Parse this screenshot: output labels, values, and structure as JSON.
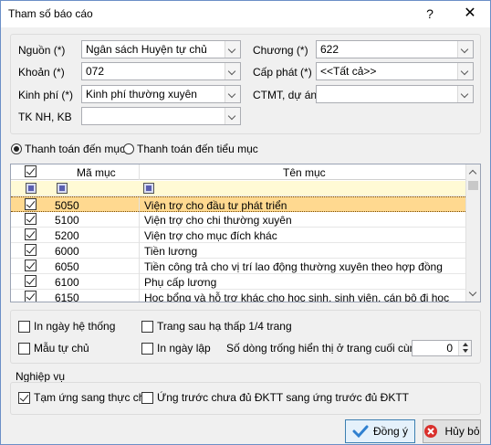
{
  "window": {
    "title": "Tham số báo cáo",
    "help": "?",
    "close": "✕"
  },
  "params": {
    "nguon": {
      "label": "Nguồn (*)",
      "value": "Ngân sách Huyện tự chủ"
    },
    "khoan": {
      "label": "Khoản (*)",
      "value": "072"
    },
    "kinhphi": {
      "label": "Kinh phí (*)",
      "value": "Kinh phí thường xuyên"
    },
    "tknh": {
      "label": "TK NH, KB",
      "value": ""
    },
    "chuong": {
      "label": "Chương (*)",
      "value": "622"
    },
    "capphat": {
      "label": "Cấp phát (*)",
      "value": "<<Tất cả>>"
    },
    "ctmt": {
      "label": "CTMT, dự án",
      "value": ""
    }
  },
  "mode": {
    "option1": "Thanh toán đến mục",
    "option2": "Thanh toán đến tiểu mục",
    "selected": "option1"
  },
  "grid": {
    "col_code": "Mã mục",
    "col_name": "Tên mục",
    "rows": [
      {
        "code": "5050",
        "name": "Viện trợ cho đầu tư phát triển",
        "checked": true,
        "selected": true
      },
      {
        "code": "5100",
        "name": "Viện trợ cho chi thường xuyên",
        "checked": true
      },
      {
        "code": "5200",
        "name": "Viện trợ cho mục đích khác",
        "checked": true
      },
      {
        "code": "6000",
        "name": "Tiền lương",
        "checked": true
      },
      {
        "code": "6050",
        "name": "Tiền công trả cho vị trí lao động thường xuyên theo hợp đồng",
        "checked": true
      },
      {
        "code": "6100",
        "name": "Phụ cấp lương",
        "checked": true
      },
      {
        "code": "6150",
        "name": "Học bổng và hỗ trợ khác cho học sinh, sinh viên, cán bộ đi học",
        "checked": true
      }
    ]
  },
  "options": {
    "in_ngay_he_thong": {
      "label": "In ngày hệ thống",
      "checked": false
    },
    "trang_sau": {
      "label": "Trang sau hạ thấp 1/4 trang",
      "checked": false
    },
    "mau_tu_chu": {
      "label": "Mẫu tự chủ",
      "checked": false
    },
    "in_ngay_lap": {
      "label": "In ngày lập",
      "checked": false
    },
    "so_dong_label": "Số dòng trống hiển thị ở trang cuối cùng",
    "so_dong_value": "0"
  },
  "nghiepvu": {
    "title": "Nghiệp vụ",
    "tam_ung": {
      "label": "Tạm ứng sang thực chi",
      "checked": true
    },
    "ung_truoc": {
      "label": "Ứng trước chưa đủ ĐKTT sang ứng trước đủ ĐKTT",
      "checked": false
    }
  },
  "buttons": {
    "ok": "Đồng ý",
    "cancel": "Hủy bỏ"
  },
  "colors": {
    "selected_row": "#ffd990",
    "filter_row": "#fffad5",
    "ok_icon": "#2f80d0",
    "cancel_icon": "#d9302c"
  }
}
